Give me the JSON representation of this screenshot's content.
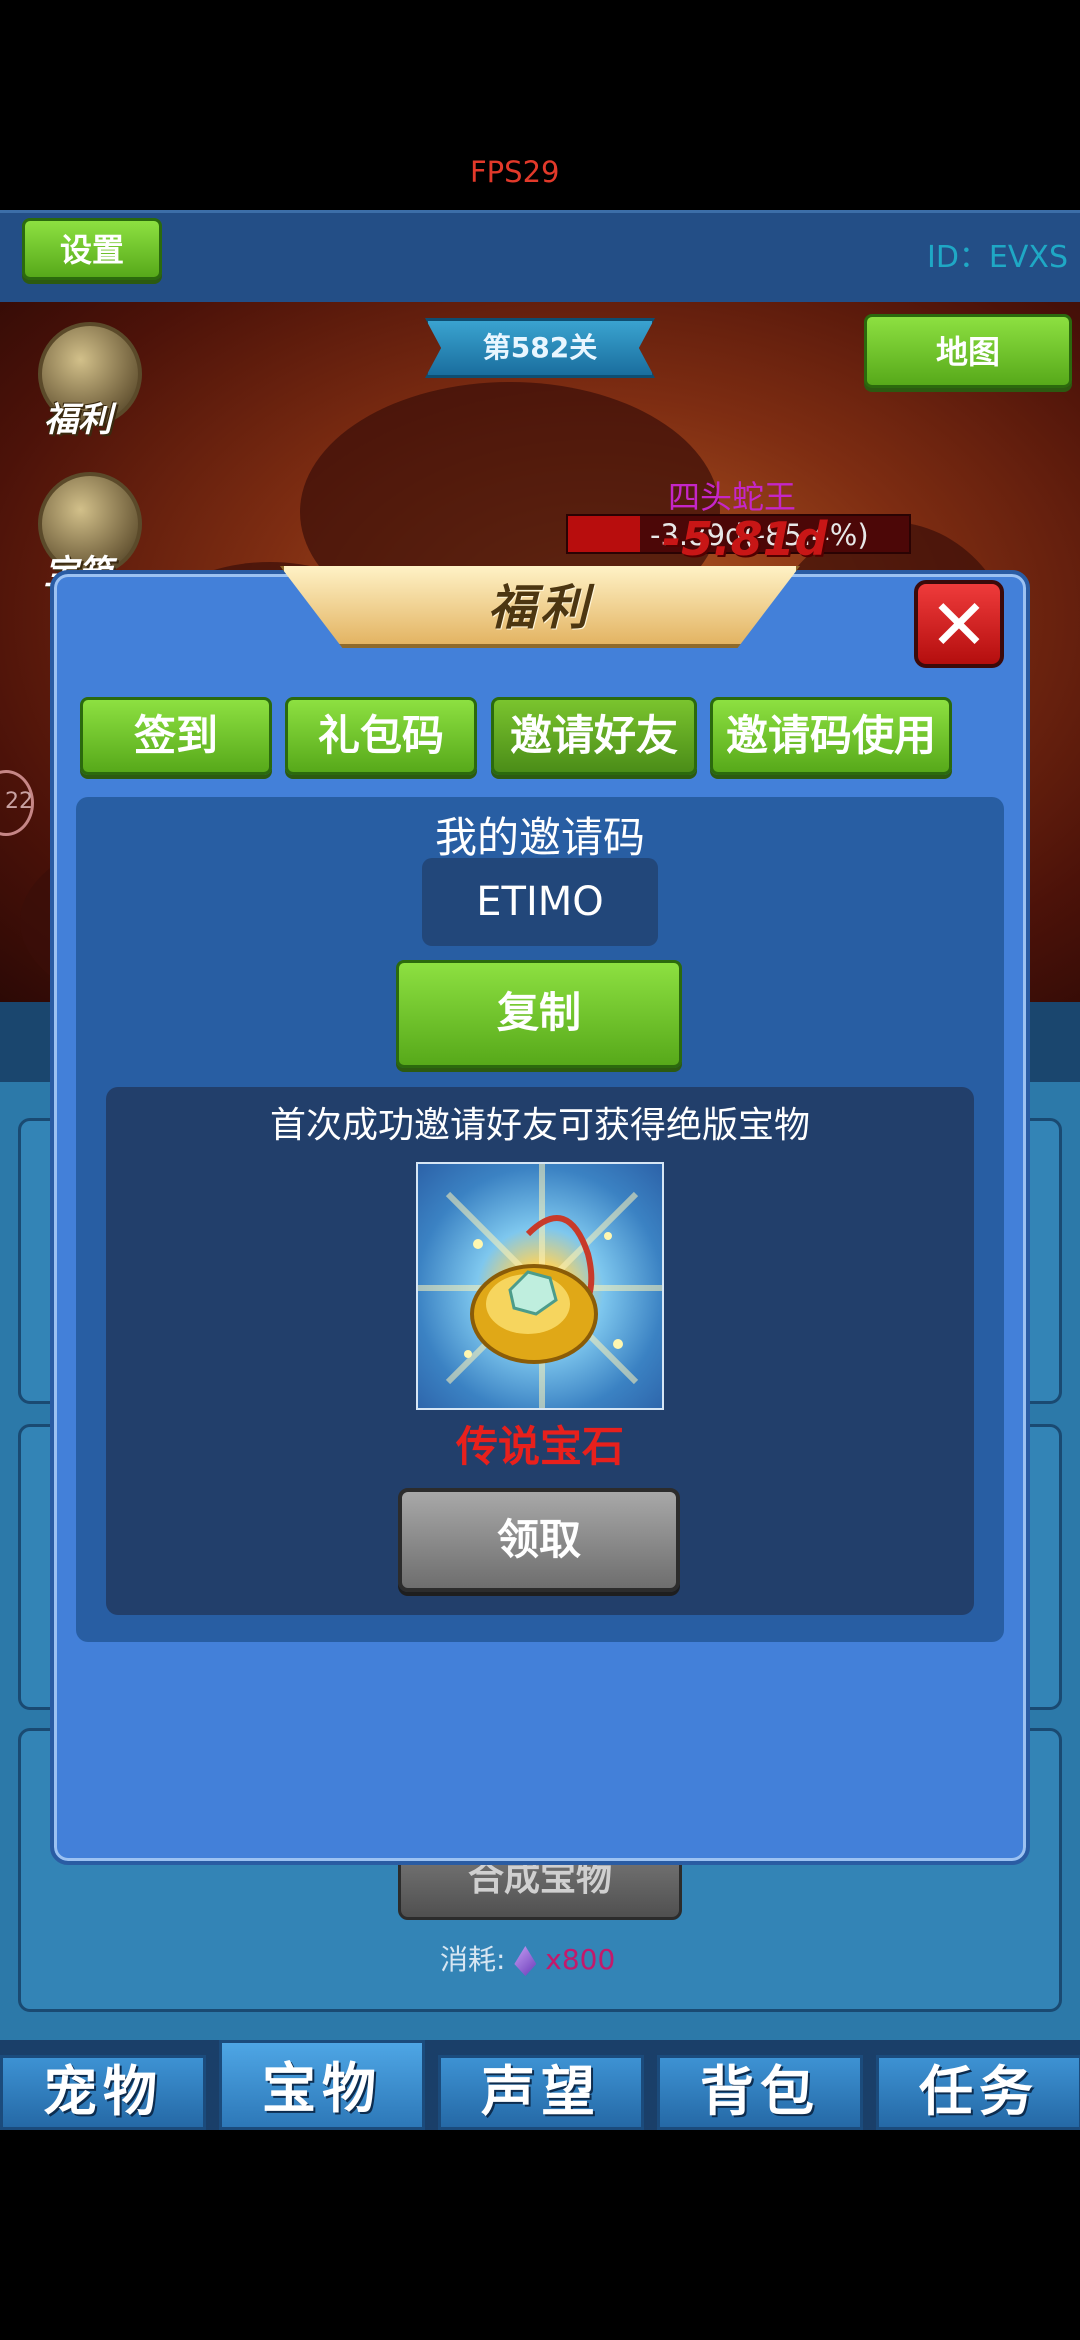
{
  "hud": {
    "fps": "FPS29",
    "settings_label": "设置",
    "player_id": "ID：EVXS"
  },
  "scene": {
    "stage_label": "第582关",
    "map_label": "地图",
    "welfare_label": "福利",
    "chest_label": "宝箱",
    "boss_name": "四头蛇王",
    "boss_hp_text": "-3.89d(-85.4%)",
    "damage_text": "-5.81d",
    "boss_hp_fraction": 0.21,
    "left_badge": "22"
  },
  "modal": {
    "title": "福利",
    "close_glyph": "✕",
    "tabs": [
      "签到",
      "礼包码",
      "邀请好友",
      "邀请码使用"
    ],
    "selected_tab": "邀请好友",
    "my_code_title": "我的邀请码",
    "my_code_value": "ETIMO",
    "copy_label": "复制",
    "reward_desc": "首次成功邀请好友可获得绝版宝物",
    "reward_name": "传说宝石",
    "claim_label": "领取"
  },
  "background_panel": {
    "compose_label": "合成宝物",
    "cost_label": "消耗:",
    "cost_amount": "x800"
  },
  "bottom_tabs": [
    "宠物",
    "宝物",
    "声望",
    "背包",
    "任务"
  ],
  "active_bottom_tab": "宝物",
  "colors": {
    "modal_blue": "#4380d9",
    "green_button": "#6cc52b",
    "reward_red": "#e8201c",
    "boss_purple": "#c526c7"
  }
}
